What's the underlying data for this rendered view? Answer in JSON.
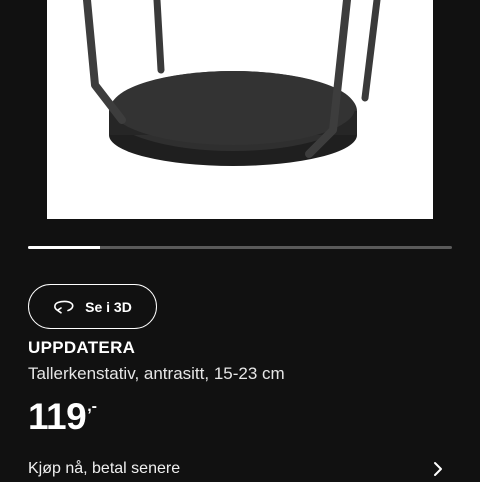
{
  "product": {
    "name": "UPPDATERA",
    "description": "Tallerkenstativ, antrasitt, 15-23 cm",
    "price_main": "119",
    "price_suffix": ",-"
  },
  "view3d": {
    "label": "Se i 3D",
    "icon": "rotate-3d-icon"
  },
  "carousel": {
    "progress": 0.17
  },
  "buy_now_pay_later": {
    "label": "Kjøp nå, betal senere",
    "icon": "chevron-right-icon"
  },
  "colors": {
    "background": "#111111",
    "image_background": "#ffffff",
    "product": "#2f2f2f",
    "text": "#ffffff",
    "track": "#5a5a5a"
  }
}
